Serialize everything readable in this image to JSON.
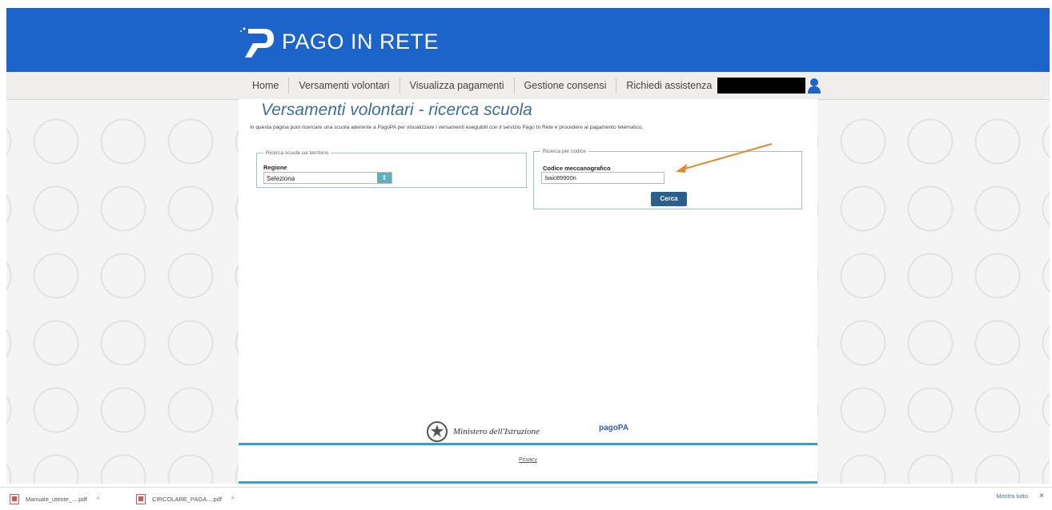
{
  "header": {
    "brand_title": "PAGO IN RETE",
    "bg_color": "#1c64c9"
  },
  "nav": {
    "items": [
      {
        "label": "Home"
      },
      {
        "label": "Versamenti volontari"
      },
      {
        "label": "Visualizza pagamenti"
      },
      {
        "label": "Gestione consensi"
      },
      {
        "label": "Richiedi assistenza"
      }
    ],
    "user_icon": "user-icon"
  },
  "main": {
    "title": "Versamenti volontari - ricerca scuola",
    "intro": "In questa pagina puoi ricercare una scuola aderente a PagoPA per visualizzare i versamenti eseguibili con il servizio Pago In Rete e procedere al pagamento telematico.",
    "region_search": {
      "legend": "Ricerca scuola sul territorio",
      "label": "Regione",
      "selected": "Seleziona"
    },
    "code_search": {
      "legend": "Ricerca per codice",
      "label": "Codice meccanografico",
      "value": "baic89900n",
      "button": "Cerca"
    },
    "accent_arrow_color": "#e08a2c"
  },
  "footer": {
    "ministry": "Ministero dell'Istruzione",
    "pagopa": "pagoPA",
    "privacy": "Privacy"
  },
  "downloads": {
    "files": [
      {
        "name": "Manuale_utente_....pdf"
      },
      {
        "name": "CIRCOLARE_PAGA....pdf"
      }
    ],
    "show_all": "Mostra tutto",
    "close": "×"
  }
}
